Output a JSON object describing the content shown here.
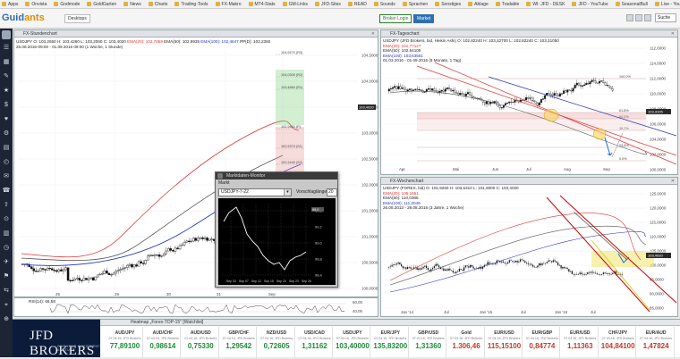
{
  "bookmarks": [
    "Apps",
    "Onvista",
    "Godmode",
    "GoldGarten",
    "News",
    "Charts",
    "Trading-Tools",
    "FX-Makro",
    "MT4-Stats",
    "GM-Links",
    "JFD-Sites",
    "READ",
    "Sounds",
    "Sprachen",
    "Sonstiges",
    "Ablage",
    "Tradable",
    "WI: JFD - DESK",
    "JFD - YouTube",
    "SeasonalBull",
    "Live - YouTube"
  ],
  "app": {
    "logo_a": "Guid",
    "logo_b": "ants",
    "workspace": "Desktops",
    "broker_btn": "Broker Login",
    "market_btn": "Market",
    "search": "Suche"
  },
  "sidebar_icons": [
    "☰",
    "▦",
    "✎",
    "★",
    "$",
    "♥",
    "⚙",
    "▤",
    "◴",
    "✉",
    "☎",
    "⇧",
    "⊙",
    "▥",
    "◷",
    "✈",
    "⚑",
    "⇆",
    "⌖",
    "⊕"
  ],
  "panels": {
    "h1": {
      "title": "FX-Stundenchart",
      "info": [
        "USDJPY O: 103,2650  H: 103,4260  L: 103,2060  C: 103,4020",
        "EMA(20): 102,7659",
        "EMA(50): 102,9935",
        "EMA(100): 102,4647",
        "PP(D): 103,2360",
        "25.08.2016-09:00 - 01.09.2016 09:00 (1 Woche, 1 Stunde)"
      ],
      "levels": [
        "104,0300 (R2)",
        "103,4860 (R1)",
        "102,9450 (P)",
        "102,5370 (S1)",
        "102,2440 (S2)",
        "104,5470 (R3)"
      ],
      "yticks": [
        "104,5000",
        "104,0000",
        "103,5000",
        "103,0000",
        "102,5000",
        "102,0000",
        "101,5000",
        "101,0000",
        "100,5000",
        "100,0000"
      ],
      "xticks": [
        "26",
        "29",
        "30",
        "31",
        "Sep"
      ],
      "last": "103,4020",
      "rsi": "RSI(14): 66,58",
      "rsi_ticks": [
        "60,00",
        "40,00"
      ]
    },
    "d1": {
      "title": "FX-Tageschart",
      "info": [
        "USDJPY (JFD Brokers, bid, Heikin Ashi)  O: 102,82240  H: 103,42700  L: 102,82240  C: 103,31050",
        "EMA(20): 101,77127",
        "EMA(50): 102,64105",
        "EMA(100): 103,63561",
        "01.03.2016 - 01.09.2016 (6 Monate, 1 Tag)"
      ],
      "yticks": [
        "112,0000",
        "114,0000",
        "112,0000",
        "110,0000",
        "108,0000",
        "106,0000",
        "104,0000",
        "102,0000",
        "100,0000"
      ],
      "fibs": [
        "100,0%",
        "61,8%",
        "50,0%",
        "38,2%",
        "23,6%",
        "0,0%"
      ],
      "xticks": [
        "Apr",
        "Mai",
        "Jun",
        "Jul",
        "Aug",
        "Sep"
      ],
      "last": "103,3105"
    },
    "w1": {
      "title": "FX-Wochenchart",
      "info": [
        "USDJPY (FOREX, bid)  O: 101,9260  H: 103,5310  L: 101,6000  C: 103,4020",
        "EMA(20): 105,1651",
        "EMA(50): 110,0386",
        "EMA(100): 111,2049",
        "26.08.2013 - 29.08.2016 (3 Jahre, 1 Woche)"
      ],
      "yticks": [
        "125,0000",
        "120,0000",
        "115,0000",
        "110,0000",
        "105,0000",
        "100,0000",
        "95,0000",
        "90,0000",
        "85,0000"
      ],
      "xticks": [
        "Jan '14",
        "Jul",
        "Jan '15",
        "Jul",
        "Jan '16",
        "Jul"
      ],
      "last": "103,4020"
    }
  },
  "popup": {
    "title": "Marktdaten-Monitor",
    "label": "Markt",
    "symbol": "USDJPY-7-22",
    "vl_label": "Vorschlaglänge:",
    "n": "20",
    "yticks": [
      "99,6",
      "99,2",
      "99,0",
      "98,8",
      "98,4"
    ],
    "last": "99,0",
    "xticks": [
      "Sep 03",
      "Sep 07",
      "Sep 12",
      "Sep 15",
      "Sep 20",
      "Sep 23",
      "Sep 26"
    ]
  },
  "watchlist": {
    "title": "Heatmap „Forex-TOP-15\" [Watchlist]",
    "items": [
      {
        "name": "AUD/JPY",
        "sub": "07.04.16, JFD Brokers",
        "value": "77,89100",
        "color": "#1e8b3a"
      },
      {
        "name": "AUD/CHF",
        "sub": "07.04.16, JFD Brokers",
        "value": "0,98614",
        "color": "#1e8b3a"
      },
      {
        "name": "AUD/USD",
        "sub": "07.04.16, JFD Brokers",
        "value": "0,75330",
        "color": "#1e8b3a"
      },
      {
        "name": "GBP/CHF",
        "sub": "07.04.16, JFD Brokers",
        "value": "1,29542",
        "color": "#1e8b3a"
      },
      {
        "name": "NZD/USD",
        "sub": "07.04.16, JFD Brokers",
        "value": "0,72605",
        "color": "#1e8b3a"
      },
      {
        "name": "USD/CAD",
        "sub": "07.04.16, JFD Brokers",
        "value": "1,31162",
        "color": "#1e8b3a"
      },
      {
        "name": "USD/JPY",
        "sub": "07.04.16, JFD Brokers",
        "value": "103,40000",
        "color": "#1e8b3a"
      },
      {
        "name": "EUR/JPY",
        "sub": "07.04.16, JFD Brokers",
        "value": "135,83200",
        "color": "#1e8b3a"
      },
      {
        "name": "GBP/USD",
        "sub": "07.04.16, JFD Brokers",
        "value": "1,31360",
        "color": "#1e8b3a"
      },
      {
        "name": "Gold",
        "sub": "07.04.16, JFD Brokers",
        "value": "1.306,46",
        "color": "#c0392b"
      },
      {
        "name": "EUR/USD",
        "sub": "07.04.16, JFD Brokers",
        "value": "115,15100",
        "color": "#c0392b"
      },
      {
        "name": "EUR/GBP",
        "sub": "07.04.16, JFD Brokers",
        "value": "0,84774",
        "color": "#c0392b"
      },
      {
        "name": "EUR/USD",
        "sub": "07.04.16, JFD Brokers",
        "value": "1,11363",
        "color": "#c0392b"
      },
      {
        "name": "CHF/JPY",
        "sub": "07.04.16, JFD Brokers",
        "value": "104,84100",
        "color": "#c0392b"
      },
      {
        "name": "EUR/AUD",
        "sub": "07.04.16, JFD Brokers",
        "value": "1,47824",
        "color": "#c0392b"
      }
    ]
  },
  "jfd": {
    "logo": "JFD BROKERS",
    "tagline": "GIVE YOUR INVESTMENT A FUTURE"
  }
}
